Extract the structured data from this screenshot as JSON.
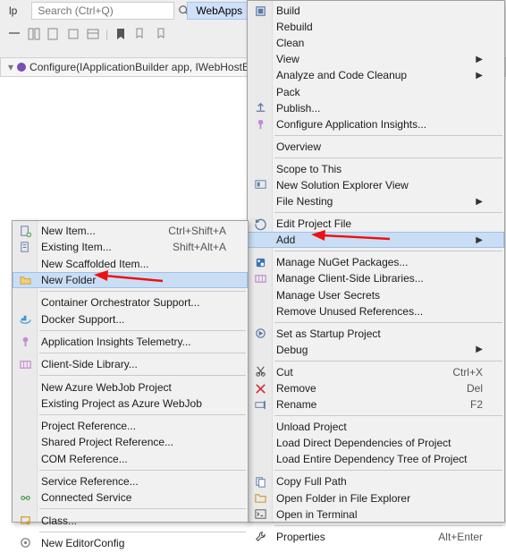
{
  "toolbar": {
    "tab_label": "lp",
    "search_placeholder": "Search (Ctrl+Q)",
    "webapps_label": "WebApps",
    "breadcrumb_text": "Configure(IApplicationBuilder app, IWebHostEn"
  },
  "main_menu": [
    {
      "icon": "build-icon",
      "label": "Build"
    },
    {
      "label": "Rebuild"
    },
    {
      "label": "Clean"
    },
    {
      "label": "View",
      "submenu": true
    },
    {
      "label": "Analyze and Code Cleanup",
      "submenu": true
    },
    {
      "label": "Pack"
    },
    {
      "icon": "publish-icon",
      "label": "Publish..."
    },
    {
      "icon": "insights-icon",
      "label": "Configure Application Insights..."
    },
    {
      "sep": true
    },
    {
      "label": "Overview"
    },
    {
      "sep": true
    },
    {
      "label": "Scope to This"
    },
    {
      "icon": "solution-icon",
      "label": "New Solution Explorer View"
    },
    {
      "label": "File Nesting",
      "submenu": true
    },
    {
      "sep": true
    },
    {
      "icon": "edit-icon",
      "label": "Edit Project File"
    },
    {
      "label": "Add",
      "submenu": true,
      "highlight": true
    },
    {
      "sep": true
    },
    {
      "icon": "nuget-icon",
      "label": "Manage NuGet Packages..."
    },
    {
      "icon": "lib-icon",
      "label": "Manage Client-Side Libraries..."
    },
    {
      "label": "Manage User Secrets"
    },
    {
      "label": "Remove Unused References..."
    },
    {
      "sep": true
    },
    {
      "icon": "startup-icon",
      "label": "Set as Startup Project"
    },
    {
      "label": "Debug",
      "submenu": true
    },
    {
      "sep": true
    },
    {
      "icon": "cut-icon",
      "label": "Cut",
      "shortcut": "Ctrl+X"
    },
    {
      "icon": "remove-icon",
      "label": "Remove",
      "shortcut": "Del"
    },
    {
      "icon": "rename-icon",
      "label": "Rename",
      "shortcut": "F2"
    },
    {
      "sep": true
    },
    {
      "label": "Unload Project"
    },
    {
      "label": "Load Direct Dependencies of Project"
    },
    {
      "label": "Load Entire Dependency Tree of Project"
    },
    {
      "sep": true
    },
    {
      "icon": "copy-icon",
      "label": "Copy Full Path"
    },
    {
      "icon": "folder-open-icon",
      "label": "Open Folder in File Explorer"
    },
    {
      "icon": "terminal-icon",
      "label": "Open in Terminal"
    },
    {
      "sep": true
    },
    {
      "icon": "wrench-icon",
      "label": "Properties",
      "shortcut": "Alt+Enter"
    }
  ],
  "sub_menu": [
    {
      "icon": "new-item-icon",
      "label": "New Item...",
      "shortcut": "Ctrl+Shift+A"
    },
    {
      "icon": "existing-item-icon",
      "label": "Existing Item...",
      "shortcut": "Shift+Alt+A"
    },
    {
      "label": "New Scaffolded Item..."
    },
    {
      "icon": "folder-icon",
      "label": "New Folder",
      "highlight": true
    },
    {
      "sep": true
    },
    {
      "label": "Container Orchestrator Support..."
    },
    {
      "icon": "docker-icon",
      "label": "Docker Support..."
    },
    {
      "sep": true
    },
    {
      "icon": "insights-icon",
      "label": "Application Insights Telemetry..."
    },
    {
      "sep": true
    },
    {
      "icon": "lib-icon",
      "label": "Client-Side Library..."
    },
    {
      "sep": true
    },
    {
      "label": "New Azure WebJob Project"
    },
    {
      "label": "Existing Project as Azure WebJob"
    },
    {
      "sep": true
    },
    {
      "label": "Project Reference..."
    },
    {
      "label": "Shared Project Reference..."
    },
    {
      "label": "COM Reference..."
    },
    {
      "sep": true
    },
    {
      "label": "Service Reference..."
    },
    {
      "icon": "connected-icon",
      "label": "Connected Service"
    },
    {
      "sep": true
    },
    {
      "icon": "class-icon",
      "label": "Class..."
    },
    {
      "sep": true
    },
    {
      "icon": "editorconfig-icon",
      "label": "New EditorConfig"
    }
  ]
}
